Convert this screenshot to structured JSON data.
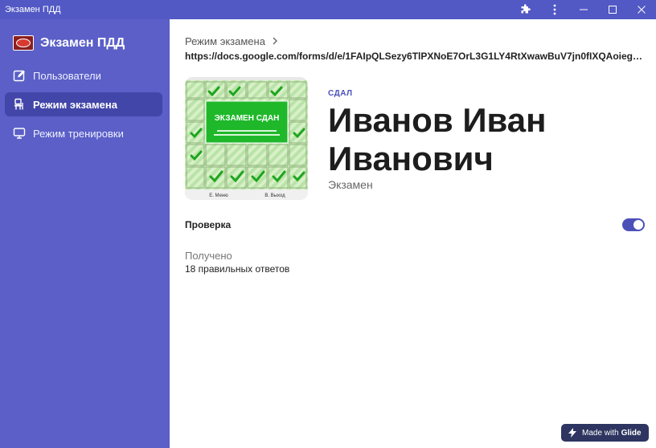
{
  "window": {
    "title": "Экзамен ПДД"
  },
  "sidebar": {
    "brand": "Экзамен ПДД",
    "items": [
      {
        "label": "Пользователи",
        "icon": "edit-square-icon",
        "active": false
      },
      {
        "label": "Режим экзамена",
        "icon": "user-desk-icon",
        "active": true
      },
      {
        "label": "Режим тренировки",
        "icon": "monitor-icon",
        "active": false
      }
    ]
  },
  "main": {
    "breadcrumb": "Режим экзамена",
    "url": "https://docs.google.com/forms/d/e/1FAIpQLSezy6TlPXNoE7OrL3G1LY4RtXwawBuV7jn0fIXQAoiegCVNt...",
    "image": {
      "banner": "ЭКЗАМЕН СДАН",
      "footer_left": "Е. Меню",
      "footer_right": "В. Выход"
    },
    "status": "СДАЛ",
    "name": "Иванов Иван Иванович",
    "subtitle": "Экзамен",
    "check_label": "Проверка",
    "check_on": true,
    "received_label": "Получено",
    "received_value": "18 правильных ответов"
  },
  "badge": {
    "prefix": "Made with",
    "brand": "Glide"
  },
  "colors": {
    "sidebar": "#5b5fc7",
    "titlebar": "#5258c4",
    "accent": "#4b50b8",
    "badge": "#2d3560"
  }
}
